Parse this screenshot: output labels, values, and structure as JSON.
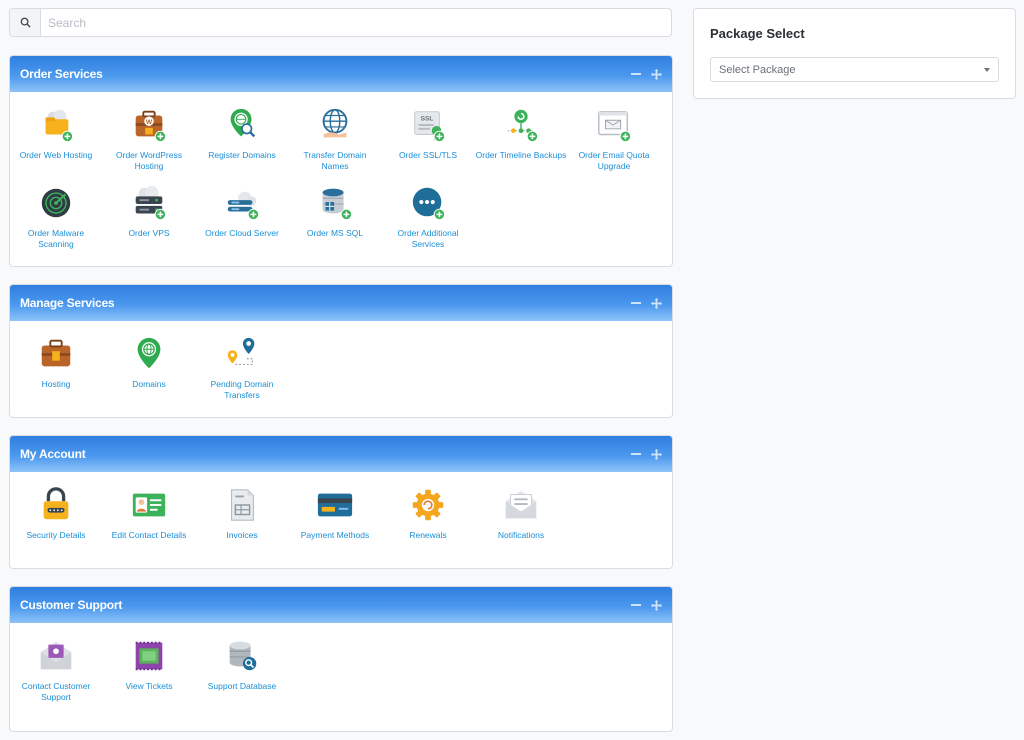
{
  "search": {
    "placeholder": "Search"
  },
  "package_select": {
    "title": "Package Select",
    "placeholder": "Select Package"
  },
  "sections": [
    {
      "title": "Order Services",
      "items": [
        {
          "label": "Order Web Hosting",
          "icon": "folder-cloud-icon"
        },
        {
          "label": "Order WordPress Hosting",
          "icon": "wordpress-briefcase-icon"
        },
        {
          "label": "Register Domains",
          "icon": "globe-pin-search-icon"
        },
        {
          "label": "Transfer Domain Names",
          "icon": "globe-hand-icon"
        },
        {
          "label": "Order SSL/TLS",
          "icon": "ssl-certificate-icon"
        },
        {
          "label": "Order Timeline Backups",
          "icon": "timeline-backup-icon"
        },
        {
          "label": "Order Email Quota Upgrade",
          "icon": "email-upgrade-icon"
        },
        {
          "label": "Order Malware Scanning",
          "icon": "radar-scan-icon"
        },
        {
          "label": "Order VPS",
          "icon": "server-cloud-icon"
        },
        {
          "label": "Order Cloud Server",
          "icon": "cloud-server-icon"
        },
        {
          "label": "Order MS SQL",
          "icon": "database-windows-icon"
        },
        {
          "label": "Order Additional Services",
          "icon": "more-services-icon"
        }
      ]
    },
    {
      "title": "Manage Services",
      "items": [
        {
          "label": "Hosting",
          "icon": "briefcase-icon"
        },
        {
          "label": "Domains",
          "icon": "globe-pin-icon"
        },
        {
          "label": "Pending Domain Transfers",
          "icon": "route-pins-icon"
        }
      ]
    },
    {
      "title": "My Account",
      "items": [
        {
          "label": "Security Details",
          "icon": "padlock-icon"
        },
        {
          "label": "Edit Contact Details",
          "icon": "contact-card-icon"
        },
        {
          "label": "Invoices",
          "icon": "invoice-icon"
        },
        {
          "label": "Payment Methods",
          "icon": "credit-card-icon"
        },
        {
          "label": "Renewals",
          "icon": "gear-renew-icon"
        },
        {
          "label": "Notifications",
          "icon": "notification-envelope-icon"
        }
      ]
    },
    {
      "title": "Customer Support",
      "items": [
        {
          "label": "Contact Customer Support",
          "icon": "support-envelope-icon"
        },
        {
          "label": "View Tickets",
          "icon": "ticket-icon"
        },
        {
          "label": "Support Database",
          "icon": "database-search-icon"
        }
      ]
    }
  ]
}
